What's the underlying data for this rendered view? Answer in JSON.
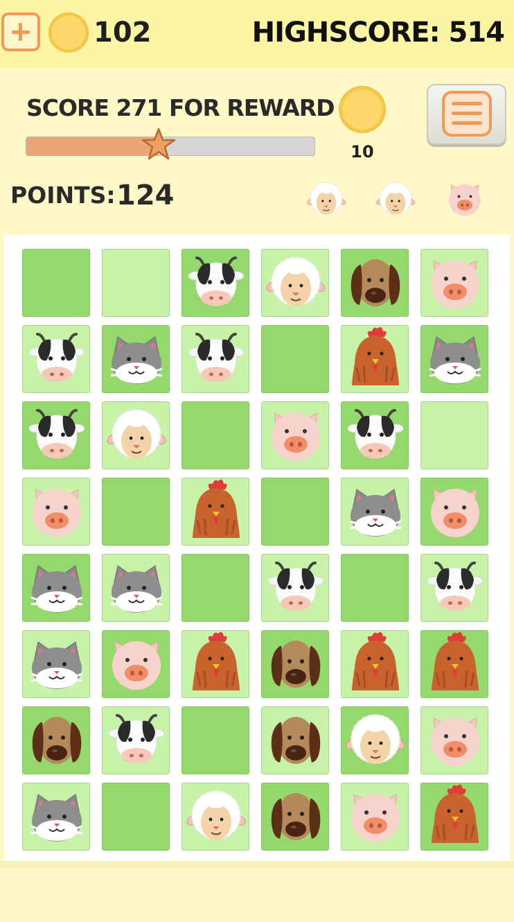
{
  "topbar": {
    "coins": "102",
    "highscore": "HIGHSCORE: 514",
    "add_icon": "plus-icon",
    "coin_icon": "coin-icon"
  },
  "reward": {
    "label": "SCORE 271 FOR REWARD",
    "progress": 0.46,
    "coin_reward": "10"
  },
  "menu_icon": "hamburger-menu-icon",
  "points": {
    "label": "POINTS:",
    "value": "124"
  },
  "targets": [
    "sheep",
    "sheep",
    "pig"
  ],
  "colors": {
    "accent": "#f19a55",
    "tile_dark": "#95d96d",
    "tile_light": "#c6f3a7",
    "progress_fill": "#eba676",
    "background": "#fef9c7"
  },
  "board": {
    "rows": [
      [
        {
          "a": null,
          "c": "dark"
        },
        {
          "a": null,
          "c": "light"
        },
        {
          "a": "cow",
          "c": "dark"
        },
        {
          "a": "sheep",
          "c": "light"
        },
        {
          "a": "dog",
          "c": "dark"
        },
        {
          "a": "pig",
          "c": "light"
        }
      ],
      [
        {
          "a": "cow",
          "c": "light"
        },
        {
          "a": "cat",
          "c": "dark"
        },
        {
          "a": "cow",
          "c": "light"
        },
        {
          "a": null,
          "c": "dark"
        },
        {
          "a": "chicken",
          "c": "light"
        },
        {
          "a": "cat",
          "c": "dark"
        }
      ],
      [
        {
          "a": "cow",
          "c": "dark"
        },
        {
          "a": "sheep",
          "c": "light"
        },
        {
          "a": null,
          "c": "dark"
        },
        {
          "a": "pig",
          "c": "light"
        },
        {
          "a": "cow",
          "c": "dark"
        },
        {
          "a": null,
          "c": "light"
        }
      ],
      [
        {
          "a": "pig",
          "c": "light"
        },
        {
          "a": null,
          "c": "dark"
        },
        {
          "a": "chicken",
          "c": "light"
        },
        {
          "a": null,
          "c": "dark"
        },
        {
          "a": "cat",
          "c": "light"
        },
        {
          "a": "pig",
          "c": "dark"
        }
      ],
      [
        {
          "a": "cat",
          "c": "dark"
        },
        {
          "a": "cat",
          "c": "light"
        },
        {
          "a": null,
          "c": "dark"
        },
        {
          "a": "cow",
          "c": "light"
        },
        {
          "a": null,
          "c": "dark"
        },
        {
          "a": "cow",
          "c": "light"
        }
      ],
      [
        {
          "a": "cat",
          "c": "light"
        },
        {
          "a": "pig",
          "c": "dark"
        },
        {
          "a": "chicken",
          "c": "light"
        },
        {
          "a": "dog",
          "c": "dark"
        },
        {
          "a": "chicken",
          "c": "light"
        },
        {
          "a": "chicken",
          "c": "dark"
        }
      ],
      [
        {
          "a": "dog",
          "c": "dark"
        },
        {
          "a": "cow",
          "c": "light"
        },
        {
          "a": null,
          "c": "dark"
        },
        {
          "a": "dog",
          "c": "light"
        },
        {
          "a": "sheep",
          "c": "dark"
        },
        {
          "a": "pig",
          "c": "light"
        }
      ],
      [
        {
          "a": "cat",
          "c": "light"
        },
        {
          "a": null,
          "c": "dark"
        },
        {
          "a": "sheep",
          "c": "light"
        },
        {
          "a": "dog",
          "c": "dark"
        },
        {
          "a": "pig",
          "c": "light"
        },
        {
          "a": "chicken",
          "c": "dark"
        }
      ]
    ]
  }
}
